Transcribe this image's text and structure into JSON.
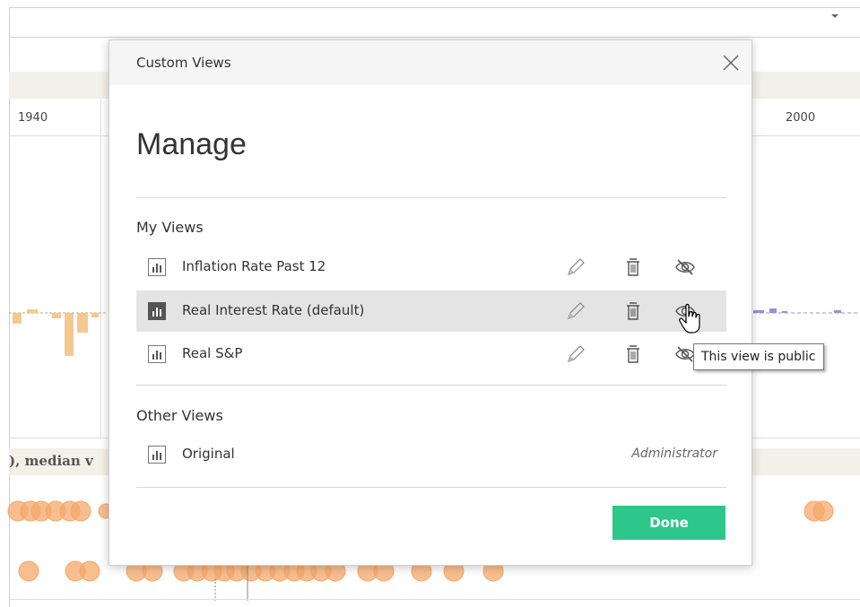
{
  "background": {
    "years": [
      "1940",
      "2000"
    ],
    "subtitle_fragment": "), median v"
  },
  "dialog": {
    "title": "Custom Views",
    "heading": "Manage",
    "my_views_label": "My Views",
    "my_views": [
      {
        "label": "Inflation Rate Past 12",
        "selected": false,
        "visibility": "private"
      },
      {
        "label": "Real Interest Rate (default)",
        "selected": true,
        "visibility": "public"
      },
      {
        "label": "Real S&P",
        "selected": false,
        "visibility": "private"
      }
    ],
    "other_views_label": "Other Views",
    "other_views": [
      {
        "label": "Original",
        "owner": "Administrator"
      }
    ],
    "done_label": "Done"
  },
  "tooltip": "This view is public",
  "colors": {
    "done_button": "#2ec78a",
    "selected_row": "#e4e4e4",
    "chart_orange": "#f5b97a",
    "chart_purple": "#9b8fd0"
  },
  "icons": {
    "close": "close-icon",
    "view": "view-chart-icon",
    "rename": "pencil-icon",
    "delete": "trash-icon",
    "private": "eye-slash-icon",
    "public": "eye-icon",
    "cursor": "hand-pointer-icon"
  }
}
